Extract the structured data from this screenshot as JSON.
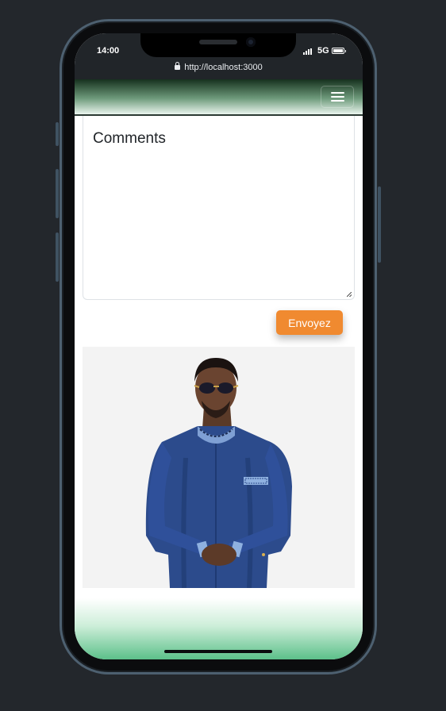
{
  "status_bar": {
    "time": "14:00",
    "network": "5G",
    "url": "http://localhost:3000"
  },
  "navbar": {
    "menu_icon": "hamburger-icon"
  },
  "form": {
    "comments_placeholder": "Comments",
    "submit_label": "Envoyez"
  },
  "colors": {
    "accent": "#f08a30",
    "navbar_dark": "#16311e",
    "footer_green": "#5cc08a"
  }
}
